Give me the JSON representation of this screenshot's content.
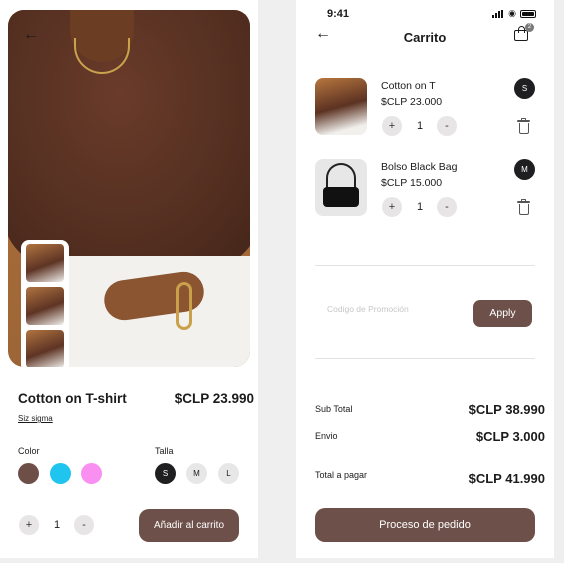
{
  "product": {
    "title": "Cotton on T-shirt",
    "price": "$CLP 23.990",
    "brand": "Siz sigma",
    "color_label": "Color",
    "size_label": "Talla",
    "colors": [
      "#6e4f47",
      "#1fc5ef",
      "#f98ff0"
    ],
    "sizes": [
      "S",
      "M",
      "L"
    ],
    "selected_size": "S",
    "quantity": "1",
    "minus": "-",
    "plus": "+",
    "add_to_cart": "Añadir al carrito"
  },
  "status_bar": {
    "time": "9:41"
  },
  "cart": {
    "title": "Carrito",
    "badge_count": "2",
    "items": [
      {
        "name": "Cotton on T",
        "price": "$CLP 23.000",
        "quantity": "1",
        "size": "S"
      },
      {
        "name": "Bolso Black Bag",
        "price": "$CLP 15.000",
        "quantity": "1",
        "size": "M"
      }
    ],
    "promo_placeholder": "Codigo de Promoción",
    "apply": "Apply",
    "subtotal_label": "Sub Total",
    "subtotal_value": "$CLP 38.990",
    "shipping_label": "Envio",
    "shipping_value": "$CLP 3.000",
    "total_label": "Total a  pagar",
    "total_value": "$CLP 41.990",
    "checkout": "Proceso de pedido"
  },
  "icons": {
    "back": "arrow-left-icon",
    "cart": "shopping-bag-icon",
    "delete": "trash-icon",
    "signal": "signal-icon",
    "wifi": "wifi-icon",
    "battery": "battery-icon"
  },
  "theme": {
    "accent": "#6d5049",
    "dark": "#1f1f22",
    "chip": "#e7e5e6"
  }
}
